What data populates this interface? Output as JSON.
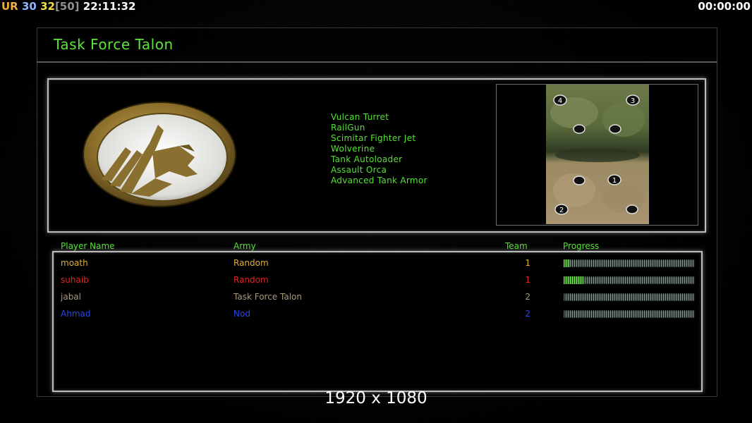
{
  "overlay": {
    "ur_label": "UR",
    "fps": "30",
    "current": "32",
    "max": "[50]",
    "clock": "22:11:32",
    "timer": "00:00:00",
    "resolution": "1920 x 1080"
  },
  "header": {
    "title": "Task Force Talon"
  },
  "faction": {
    "logo_icon": "eagle-emblem-icon",
    "units": [
      "Vulcan Turret",
      "RailGun",
      "Scimitar Fighter Jet",
      "Wolverine",
      "Tank Autoloader",
      "Assault Orca",
      "Advanced Tank Armor"
    ]
  },
  "map": {
    "start_positions": [
      "4",
      "3",
      "1",
      "2"
    ]
  },
  "players": {
    "columns": {
      "name": "Player Name",
      "army": "Army",
      "team": "Team",
      "progress": "Progress"
    },
    "rows": [
      {
        "name": "moath",
        "army": "Random",
        "team": "1",
        "color": "#e0b040",
        "progress": 0.05
      },
      {
        "name": "suhaib",
        "army": "Random",
        "team": "1",
        "color": "#e02424",
        "progress": 0.15
      },
      {
        "name": "jabal",
        "army": "Task Force Talon",
        "team": "2",
        "color": "#a89a7a",
        "progress": 0.0
      },
      {
        "name": "Ahmad",
        "army": "Nod",
        "team": "2",
        "color": "#2a46ee",
        "progress": 0.0
      }
    ]
  },
  "colors": {
    "accent_green": "#58e038",
    "frame_border": "#bcbcbc"
  }
}
